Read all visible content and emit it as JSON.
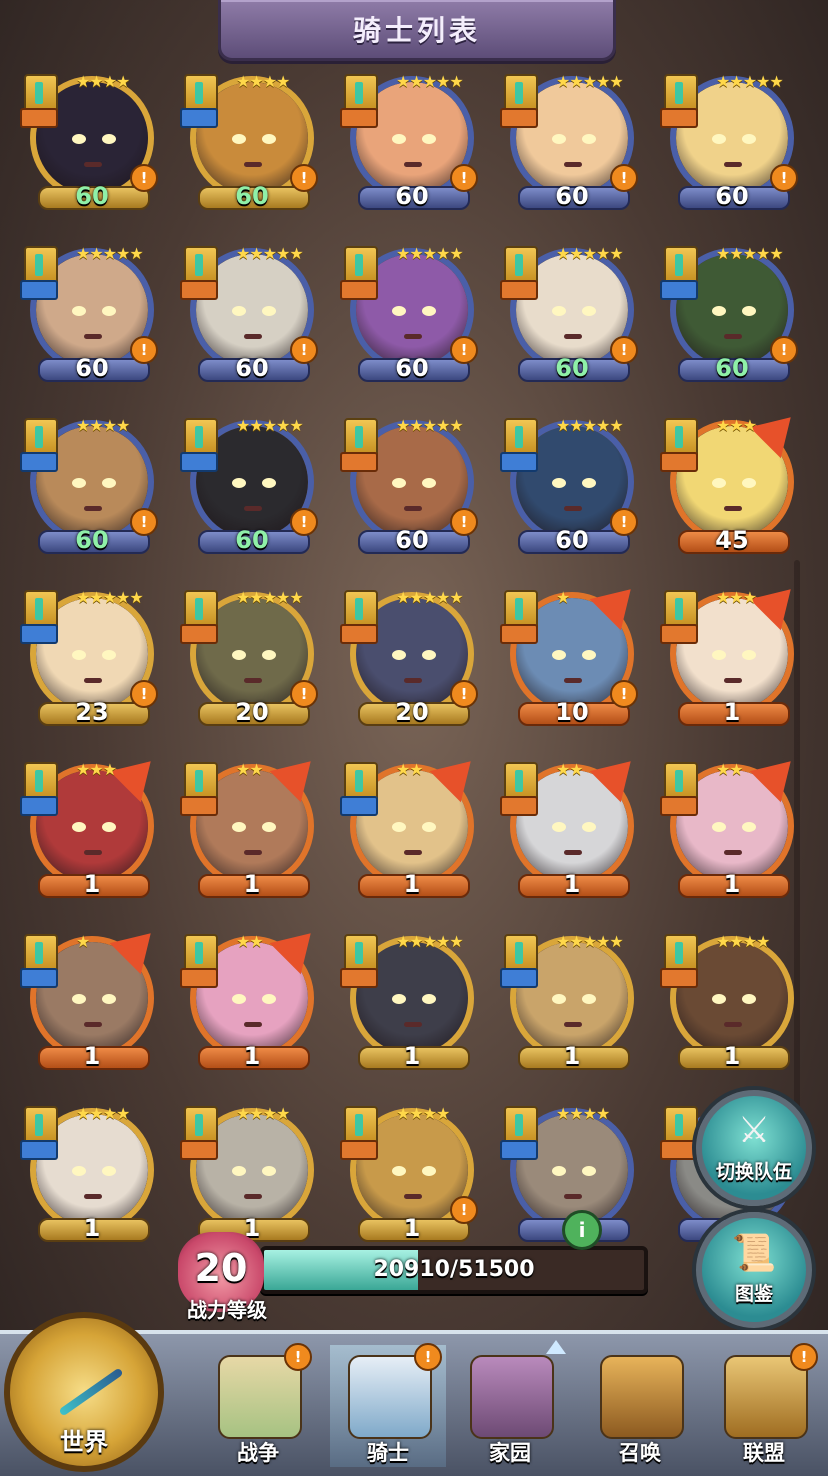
{
  "title": "骑士列表",
  "knights": [
    {
      "level": "60",
      "level_color": "green",
      "stars": "★★★★",
      "frame": "gold",
      "alert": "!",
      "face": "#2a2436",
      "new": false,
      "cls": "orange"
    },
    {
      "level": "60",
      "level_color": "green",
      "stars": "★★★★",
      "frame": "gold",
      "alert": "!",
      "face": "#c98b3b",
      "new": false,
      "cls": "blue"
    },
    {
      "level": "60",
      "level_color": "white",
      "stars": "★★★★★",
      "frame": "blue",
      "alert": "!",
      "face": "#e9a47a",
      "new": false,
      "cls": "orange"
    },
    {
      "level": "60",
      "level_color": "white",
      "stars": "★★★★★",
      "frame": "blue",
      "alert": "!",
      "face": "#f0c99b",
      "new": false,
      "cls": "orange"
    },
    {
      "level": "60",
      "level_color": "white",
      "stars": "★★★★★",
      "frame": "blue",
      "alert": "!",
      "face": "#f0d28a",
      "new": false,
      "cls": "orange"
    },
    {
      "level": "60",
      "level_color": "white",
      "stars": "★★★★★",
      "frame": "blue",
      "alert": "!",
      "face": "#cfa98a",
      "new": false,
      "cls": "blue"
    },
    {
      "level": "60",
      "level_color": "white",
      "stars": "★★★★★",
      "frame": "blue",
      "alert": "!",
      "face": "#d6d0c4",
      "new": false,
      "cls": "orange"
    },
    {
      "level": "60",
      "level_color": "white",
      "stars": "★★★★★",
      "frame": "blue",
      "alert": "!",
      "face": "#8e5aa8",
      "new": false,
      "cls": "orange"
    },
    {
      "level": "60",
      "level_color": "green",
      "stars": "★★★★★",
      "frame": "blue",
      "alert": "!",
      "face": "#e8dccb",
      "new": false,
      "cls": "orange"
    },
    {
      "level": "60",
      "level_color": "green",
      "stars": "★★★★★",
      "frame": "blue",
      "alert": "!",
      "face": "#3f5a35",
      "new": false,
      "cls": "blue"
    },
    {
      "level": "60",
      "level_color": "green",
      "stars": "★★★★",
      "frame": "blue",
      "alert": "!",
      "face": "#b98a5a",
      "new": false,
      "cls": "blue"
    },
    {
      "level": "60",
      "level_color": "green",
      "stars": "★★★★★",
      "frame": "blue",
      "alert": "!",
      "face": "#2b2a2e",
      "new": false,
      "cls": "blue"
    },
    {
      "level": "60",
      "level_color": "white",
      "stars": "★★★★★",
      "frame": "blue",
      "alert": "!",
      "face": "#a86a48",
      "new": false,
      "cls": "orange"
    },
    {
      "level": "60",
      "level_color": "white",
      "stars": "★★★★★",
      "frame": "blue",
      "alert": "!",
      "face": "#314a6e",
      "new": false,
      "cls": "blue"
    },
    {
      "level": "45",
      "level_color": "white",
      "stars": "★★★",
      "frame": "orange",
      "alert": "",
      "face": "#f1d774",
      "new": true,
      "cls": "orange"
    },
    {
      "level": "23",
      "level_color": "white",
      "stars": "★★★★★",
      "frame": "gold",
      "alert": "!",
      "face": "#f0d8b4",
      "new": false,
      "cls": "blue"
    },
    {
      "level": "20",
      "level_color": "white",
      "stars": "★★★★★",
      "frame": "gold",
      "alert": "!",
      "face": "#6f6a4a",
      "new": false,
      "cls": "orange"
    },
    {
      "level": "20",
      "level_color": "white",
      "stars": "★★★★★",
      "frame": "gold",
      "alert": "!",
      "face": "#4a4e6e",
      "new": false,
      "cls": "orange"
    },
    {
      "level": "10",
      "level_color": "white",
      "stars": "★",
      "frame": "orange",
      "alert": "!",
      "face": "#6c8cb4",
      "new": true,
      "cls": "orange"
    },
    {
      "level": "1",
      "level_color": "white",
      "stars": "★★★",
      "frame": "orange",
      "alert": "",
      "face": "#f2e0cc",
      "new": true,
      "cls": "orange"
    },
    {
      "level": "1",
      "level_color": "white",
      "stars": "★★★",
      "frame": "orange",
      "alert": "",
      "face": "#b03a3a",
      "new": true,
      "cls": "blue"
    },
    {
      "level": "1",
      "level_color": "white",
      "stars": "★★",
      "frame": "orange",
      "alert": "",
      "face": "#b07a5a",
      "new": true,
      "cls": "orange"
    },
    {
      "level": "1",
      "level_color": "white",
      "stars": "★★",
      "frame": "orange",
      "alert": "",
      "face": "#e2c28a",
      "new": true,
      "cls": "blue"
    },
    {
      "level": "1",
      "level_color": "white",
      "stars": "★★",
      "frame": "orange",
      "alert": "",
      "face": "#d6d6d8",
      "new": true,
      "cls": "orange"
    },
    {
      "level": "1",
      "level_color": "white",
      "stars": "★★",
      "frame": "orange",
      "alert": "",
      "face": "#e8b8c8",
      "new": true,
      "cls": "orange"
    },
    {
      "level": "1",
      "level_color": "white",
      "stars": "★",
      "frame": "orange",
      "alert": "",
      "face": "#9a7a64",
      "new": true,
      "cls": "blue"
    },
    {
      "level": "1",
      "level_color": "white",
      "stars": "★★",
      "frame": "orange",
      "alert": "",
      "face": "#e6a2c0",
      "new": true,
      "cls": "orange"
    },
    {
      "level": "1",
      "level_color": "white",
      "stars": "★★★★★",
      "frame": "gold",
      "alert": "",
      "face": "#3e3e4a",
      "new": false,
      "cls": "orange"
    },
    {
      "level": "1",
      "level_color": "white",
      "stars": "★★★★★",
      "frame": "gold",
      "alert": "",
      "face": "#c9a46a",
      "new": false,
      "cls": "blue"
    },
    {
      "level": "1",
      "level_color": "white",
      "stars": "★★★★",
      "frame": "gold",
      "alert": "",
      "face": "#6a4a34",
      "new": false,
      "cls": "orange"
    },
    {
      "level": "1",
      "level_color": "white",
      "stars": "★★★★",
      "frame": "gold",
      "alert": "",
      "face": "#e6dcd0",
      "new": false,
      "cls": "blue"
    },
    {
      "level": "1",
      "level_color": "white",
      "stars": "★★★★",
      "frame": "gold",
      "alert": "",
      "face": "#b8b2a6",
      "new": false,
      "cls": "orange"
    },
    {
      "level": "1",
      "level_color": "white",
      "stars": "★★★★",
      "frame": "gold",
      "alert": "!",
      "face": "#c89a4a",
      "new": false,
      "cls": "orange"
    },
    {
      "level": "",
      "level_color": "white",
      "stars": "★★★★",
      "frame": "blue",
      "alert": "",
      "face": "#9a8a7a",
      "new": false,
      "cls": "blue"
    },
    {
      "level": "",
      "level_color": "white",
      "stars": "",
      "frame": "blue",
      "alert": "",
      "face": "#8a8a86",
      "new": false,
      "cls": "orange"
    }
  ],
  "side_buttons": {
    "switch_team": "切换队伍",
    "codex": "图鉴"
  },
  "power": {
    "level": "20",
    "label": "战力等级",
    "xp_text": "20910/51500",
    "xp_fraction": 0.406,
    "info": "i"
  },
  "nav": {
    "world": "世界",
    "tabs": [
      {
        "label": "战争",
        "badge": "!",
        "icon": "map"
      },
      {
        "label": "骑士",
        "badge": "!",
        "icon": "knight"
      },
      {
        "label": "家园",
        "badge": "",
        "icon": "home"
      },
      {
        "label": "召唤",
        "badge": "",
        "icon": "train"
      },
      {
        "label": "联盟",
        "badge": "!",
        "icon": "guild"
      }
    ]
  }
}
